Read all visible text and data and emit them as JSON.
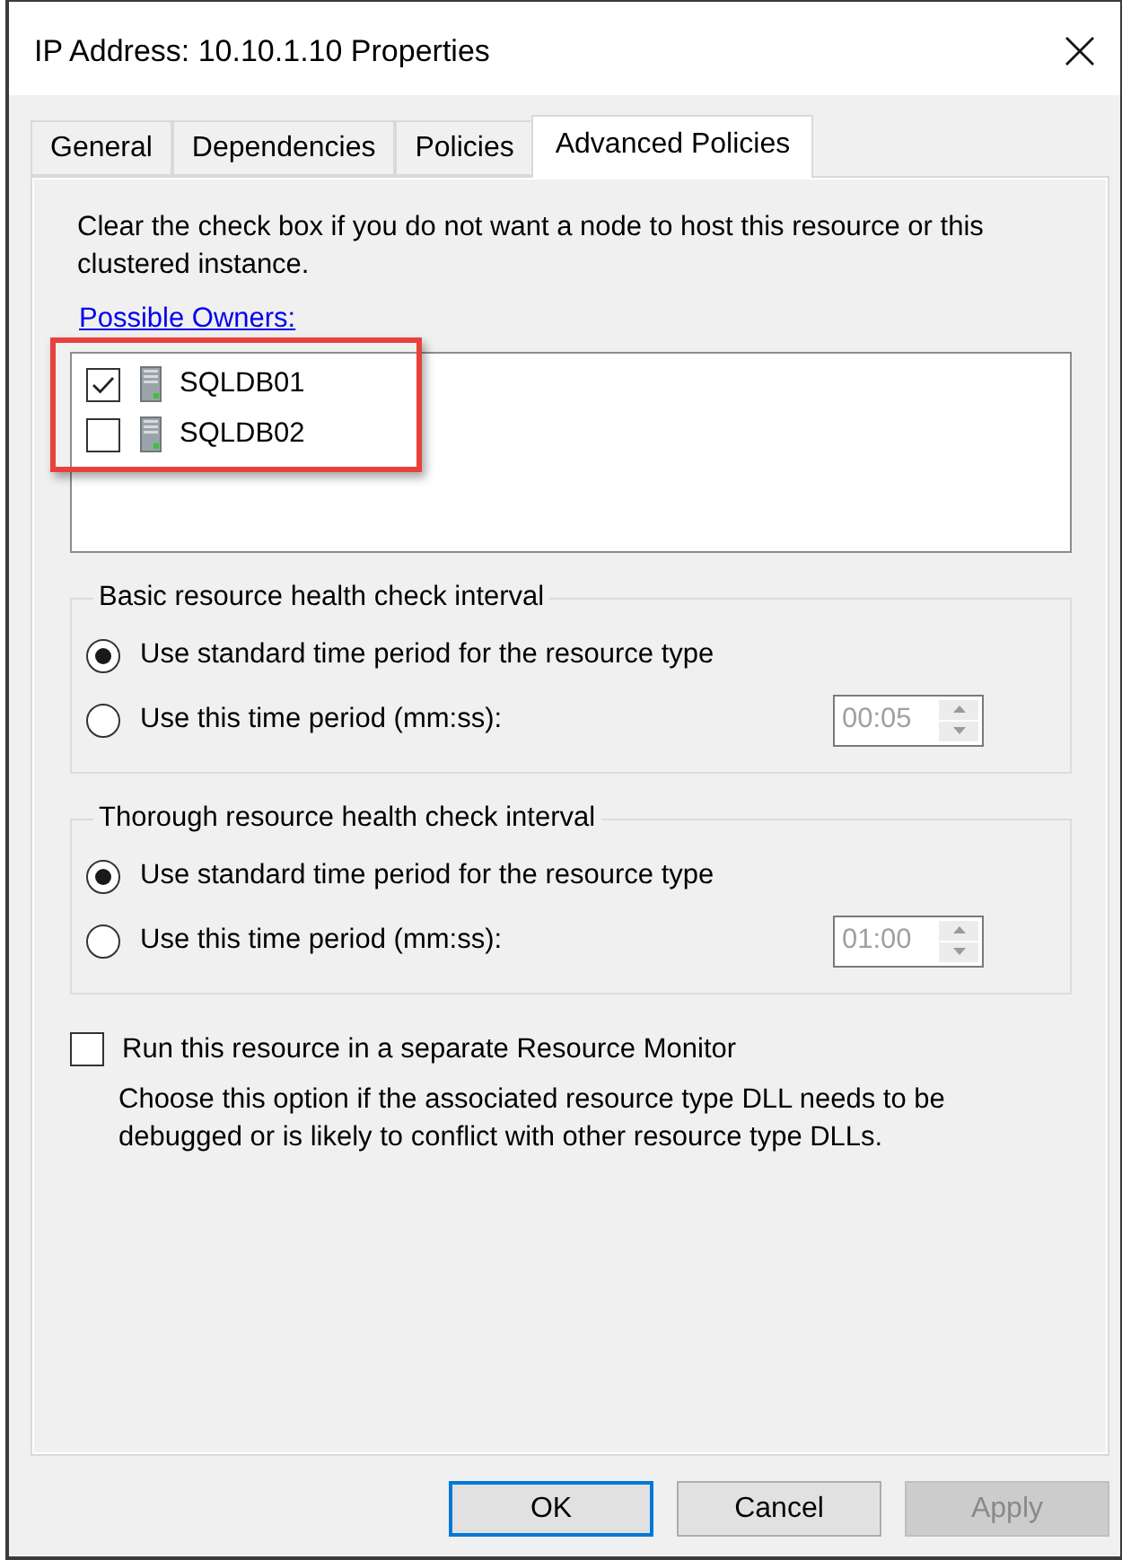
{
  "window": {
    "title": "IP Address: 10.10.1.10 Properties"
  },
  "tabs": [
    {
      "label": "General",
      "selected": false
    },
    {
      "label": "Dependencies",
      "selected": false
    },
    {
      "label": "Policies",
      "selected": false
    },
    {
      "label": "Advanced Policies",
      "selected": true
    }
  ],
  "advanced_policies": {
    "description": "Clear the check box if you do not want a node to host this resource or this clustered instance.",
    "possible_owners": {
      "label": "Possible Owners:",
      "highlighted": true,
      "items": [
        {
          "name": "SQLDB01",
          "checked": true
        },
        {
          "name": "SQLDB02",
          "checked": false
        }
      ]
    },
    "intervals": [
      {
        "title": "Basic resource health check interval",
        "options": [
          {
            "label": "Use standard time period for the resource type",
            "selected": true
          },
          {
            "label": "Use this time period (mm:ss):",
            "selected": false
          }
        ],
        "time": {
          "value": "00:05",
          "disabled": true
        }
      },
      {
        "title": "Thorough resource health check interval",
        "options": [
          {
            "label": "Use standard time period for the resource type",
            "selected": true
          },
          {
            "label": "Use this time period (mm:ss):",
            "selected": false
          }
        ],
        "time": {
          "value": "01:00",
          "disabled": true
        }
      }
    ],
    "separate_monitor": {
      "label": "Run this resource in a separate Resource Monitor",
      "checked": false,
      "description": "Choose this option if the associated resource type DLL needs to be debugged or is likely to conflict with other resource type DLLs."
    }
  },
  "buttons": [
    {
      "label": "OK",
      "default": true,
      "disabled": false
    },
    {
      "label": "Cancel",
      "default": false,
      "disabled": false
    },
    {
      "label": "Apply",
      "default": false,
      "disabled": true
    }
  ]
}
